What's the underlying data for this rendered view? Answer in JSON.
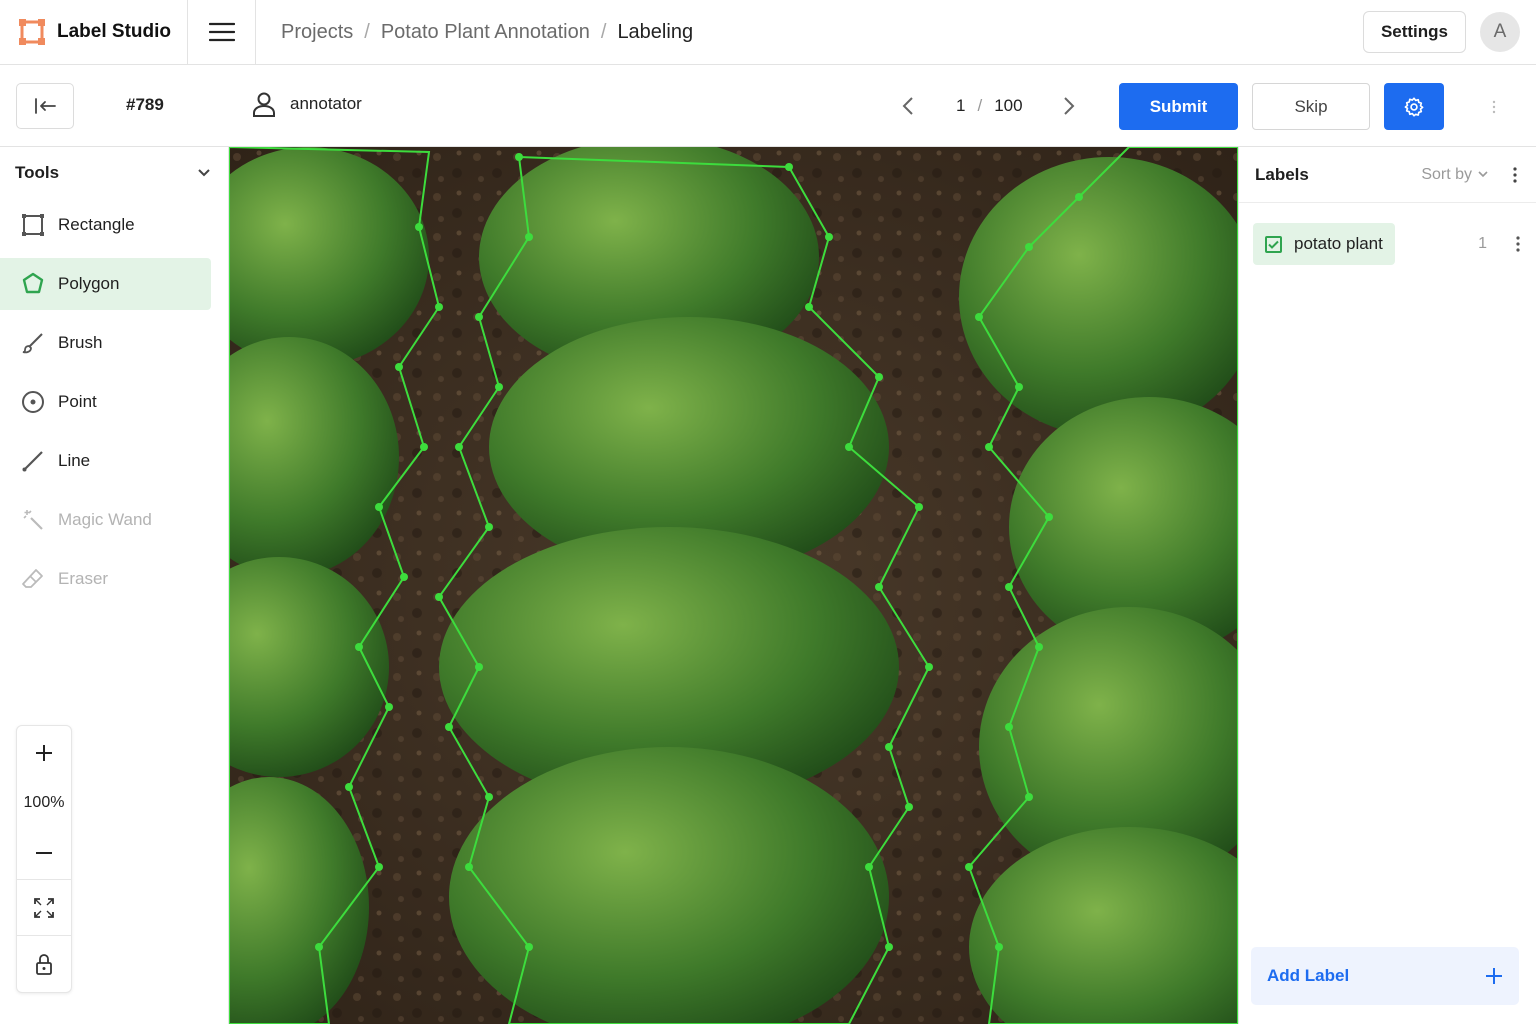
{
  "app": {
    "name": "Label Studio"
  },
  "breadcrumb": {
    "items": [
      "Projects",
      "Potato Plant Annotation",
      "Labeling"
    ],
    "separator": "/"
  },
  "header": {
    "settings_label": "Settings",
    "avatar_initial": "A"
  },
  "toolbar": {
    "task_id": "#789",
    "user_name": "annotator",
    "page_current": "1",
    "page_separator": "/",
    "page_total": "100",
    "submit_label": "Submit",
    "skip_label": "Skip"
  },
  "tools": {
    "title": "Tools",
    "items": [
      {
        "label": "Rectangle",
        "icon": "rectangle-icon",
        "state": "normal"
      },
      {
        "label": "Polygon",
        "icon": "polygon-icon",
        "state": "active"
      },
      {
        "label": "Brush",
        "icon": "brush-icon",
        "state": "normal"
      },
      {
        "label": "Point",
        "icon": "point-icon",
        "state": "normal"
      },
      {
        "label": "Line",
        "icon": "line-icon",
        "state": "normal"
      },
      {
        "label": "Magic Wand",
        "icon": "magic-wand-icon",
        "state": "disabled"
      },
      {
        "label": "Eraser",
        "icon": "eraser-icon",
        "state": "disabled"
      }
    ]
  },
  "zoom": {
    "level": "100%"
  },
  "labels_panel": {
    "title": "Labels",
    "sort_label": "Sort by",
    "items": [
      {
        "name": "potato plant",
        "count": "1",
        "checked": true
      }
    ],
    "add_label": "Add Label"
  },
  "colors": {
    "accent": "#1d6cf0",
    "active_tool_bg": "#e3f3e6",
    "label_green": "#2fa44f",
    "polygon_stroke": "#3ddc3d",
    "brand_orange": "#f08a5d"
  }
}
